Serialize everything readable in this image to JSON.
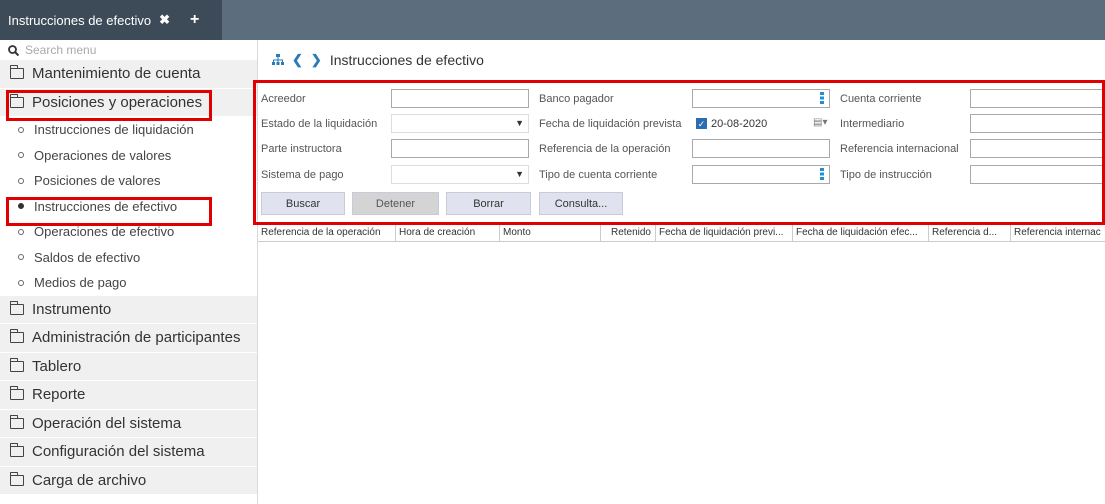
{
  "tab": {
    "title": "Instrucciones de efectivo",
    "close_icon": "✖",
    "add_icon": "+"
  },
  "sidebar": {
    "search_placeholder": "Search menu",
    "categories": [
      {
        "label": "Mantenimiento de cuenta"
      },
      {
        "label": "Posiciones y operaciones",
        "expanded": true,
        "items": [
          {
            "label": "Instrucciones de liquidación"
          },
          {
            "label": "Operaciones de valores"
          },
          {
            "label": "Posiciones de valores"
          },
          {
            "label": "Instrucciones de efectivo",
            "active": true
          },
          {
            "label": "Operaciones de efectivo"
          },
          {
            "label": "Saldos de efectivo"
          },
          {
            "label": "Medios de pago"
          }
        ]
      },
      {
        "label": "Instrumento"
      },
      {
        "label": "Administración de participantes"
      },
      {
        "label": "Tablero"
      },
      {
        "label": "Reporte"
      },
      {
        "label": "Operación del sistema"
      },
      {
        "label": "Configuración del sistema"
      },
      {
        "label": "Carga de archivo"
      }
    ]
  },
  "header": {
    "title": "Instrucciones de efectivo"
  },
  "form": {
    "acreedor": {
      "label": "Acreedor",
      "value": ""
    },
    "banco_pagador": {
      "label": "Banco pagador",
      "value": ""
    },
    "cuenta_corriente": {
      "label": "Cuenta corriente",
      "value": ""
    },
    "estado_liquidacion": {
      "label": "Estado de la liquidación",
      "value": ""
    },
    "fecha_liquidacion": {
      "label": "Fecha de liquidación prevista",
      "value": "20-08-2020",
      "checked": true
    },
    "intermediario": {
      "label": "Intermediario",
      "value": ""
    },
    "parte_instructora": {
      "label": "Parte instructora",
      "value": ""
    },
    "referencia_operacion": {
      "label": "Referencia de la operación",
      "value": ""
    },
    "referencia_internacional": {
      "label": "Referencia internacional",
      "value": ""
    },
    "sistema_pago": {
      "label": "Sistema de pago",
      "value": ""
    },
    "tipo_cuenta_corriente": {
      "label": "Tipo de cuenta corriente",
      "value": ""
    },
    "tipo_instruccion": {
      "label": "Tipo de instrucción",
      "value": ""
    },
    "buttons": {
      "buscar": "Buscar",
      "detener": "Detener",
      "borrar": "Borrar",
      "consulta": "Consulta..."
    }
  },
  "table": {
    "columns": [
      "Referencia de la operación",
      "Hora de creación",
      "Monto",
      "Retenido",
      "Fecha de liquidación previ...",
      "Fecha de liquidación efec...",
      "Referencia d...",
      "Referencia internac"
    ]
  },
  "colors": {
    "highlight": "#e00000",
    "tabbar": "#5c6d7e",
    "accent": "#1e90d6"
  }
}
